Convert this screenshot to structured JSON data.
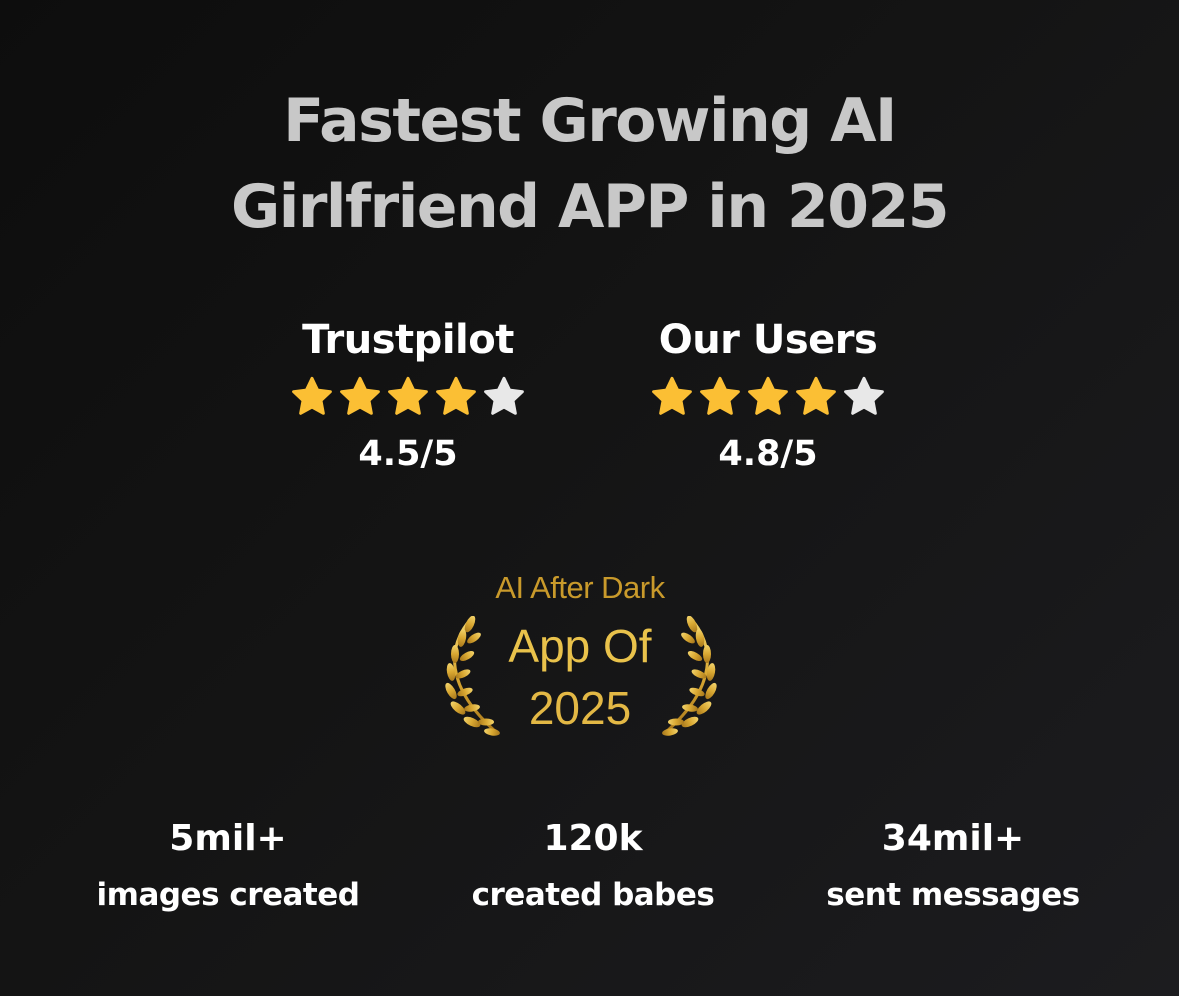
{
  "headline": {
    "line1": "Fastest Growing AI",
    "line2": "Girlfriend APP in 2025"
  },
  "ratings": [
    {
      "name": "Trustpilot",
      "score": "4.5/5",
      "value": 4.5,
      "max": 5
    },
    {
      "name": "Our Users",
      "score": "4.8/5",
      "value": 4.8,
      "max": 5
    }
  ],
  "award": {
    "org": "AI After Dark",
    "title": "App Of",
    "year": "2025"
  },
  "stats": [
    {
      "value": "5mil+",
      "label": "images created"
    },
    {
      "value": "120k",
      "label": "created babes"
    },
    {
      "value": "34mil+",
      "label": "sent messages"
    }
  ],
  "icons": {
    "star_filled": "star-icon",
    "star_empty": "star-empty-icon",
    "laurel": "laurel-wreath-icon"
  },
  "colors": {
    "background": "#121212",
    "headline": "#c8c8c8",
    "star_filled": "#fbbf34",
    "star_empty": "#e8e8e8",
    "gold": "#e0b445"
  }
}
